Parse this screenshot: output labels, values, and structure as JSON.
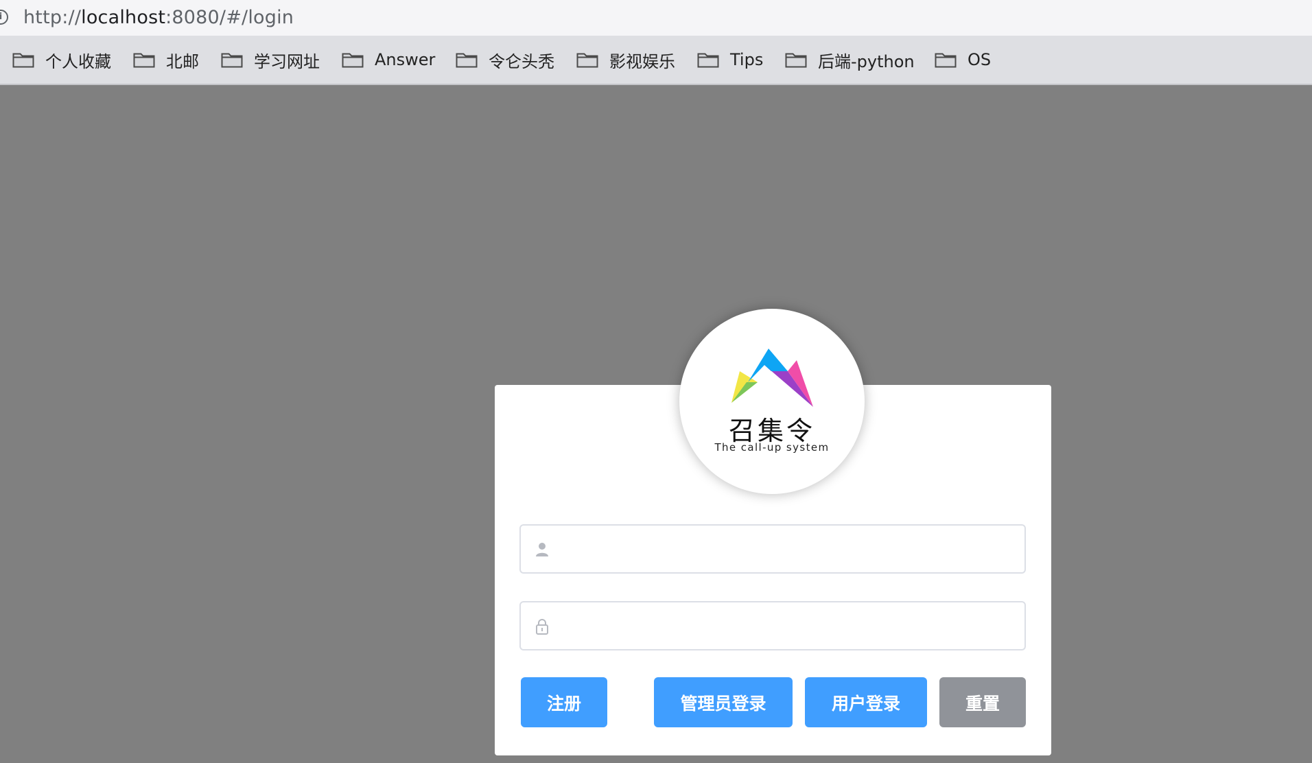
{
  "browser": {
    "url_scheme": "http://",
    "url_host": "localhost",
    "url_rest": ":8080/#/login",
    "info_icon": "i"
  },
  "bookmarks": [
    {
      "label": "个人收藏",
      "icon": "folder-icon"
    },
    {
      "label": "北邮",
      "icon": "folder-icon"
    },
    {
      "label": "学习网址",
      "icon": "folder-icon"
    },
    {
      "label": "Answer",
      "icon": "folder-icon"
    },
    {
      "label": "令仑头秃",
      "icon": "folder-icon"
    },
    {
      "label": "影视娱乐",
      "icon": "folder-icon"
    },
    {
      "label": "Tips",
      "icon": "folder-icon"
    },
    {
      "label": "后端-python",
      "icon": "folder-icon"
    },
    {
      "label": "OS",
      "icon": "folder-icon"
    }
  ],
  "logo": {
    "title": "召集令",
    "subtitle": "The call-up system",
    "colors": [
      "#0ea5f4",
      "#9b40c7",
      "#f04da8",
      "#f2e646",
      "#7cc65a"
    ]
  },
  "form": {
    "username": {
      "value": "",
      "placeholder": "",
      "icon": "user-icon"
    },
    "password": {
      "value": "",
      "placeholder": "",
      "icon": "lock-icon"
    }
  },
  "buttons": {
    "register": "注册",
    "admin_login": "管理员登录",
    "user_login": "用户登录",
    "reset": "重置"
  },
  "colors": {
    "page_background": "#808080",
    "primary": "#409eff",
    "info": "#909399",
    "card": "#ffffff"
  }
}
